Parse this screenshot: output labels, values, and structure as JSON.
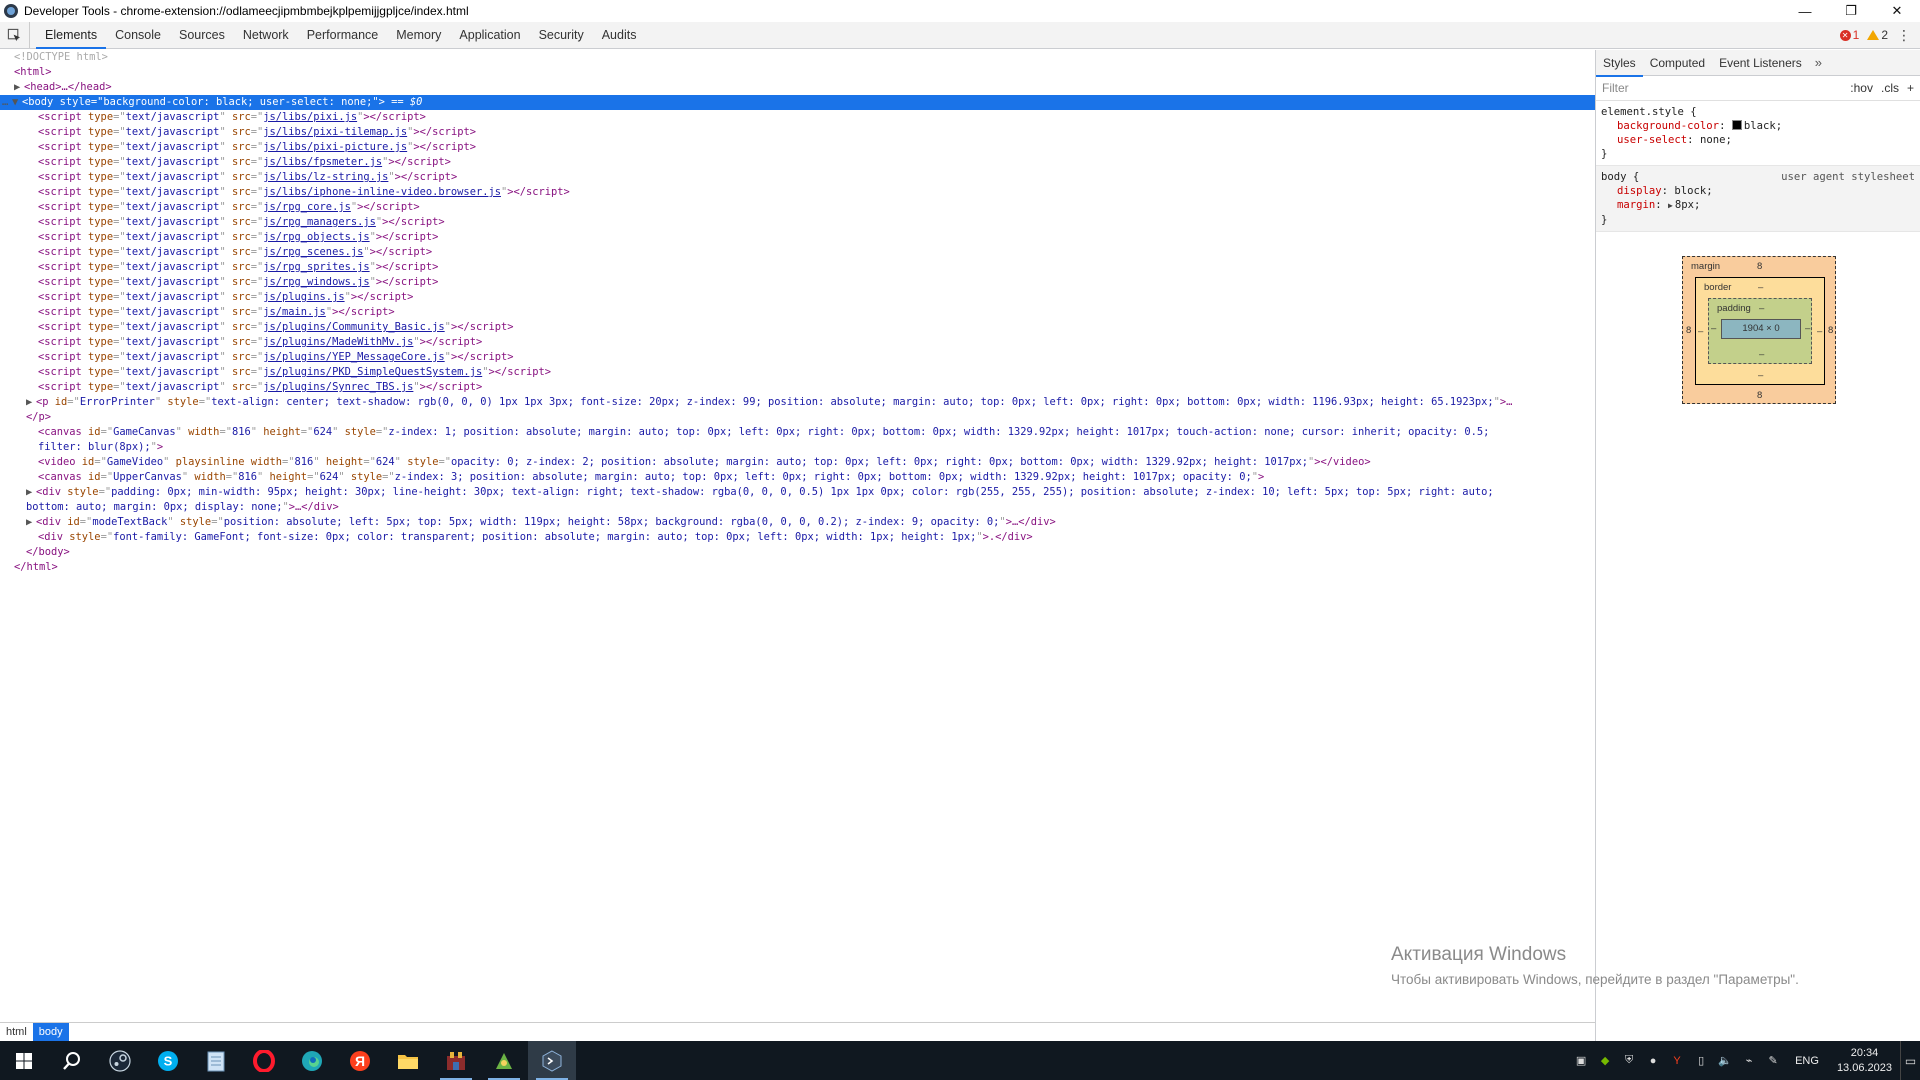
{
  "window": {
    "title": "Developer Tools - chrome-extension://odlameecjipmbmbejkplpemijjgpljce/index.html",
    "controls": [
      "—",
      "❐",
      "✕"
    ]
  },
  "devtools": {
    "tabs": [
      "Elements",
      "Console",
      "Sources",
      "Network",
      "Performance",
      "Memory",
      "Application",
      "Security",
      "Audits"
    ],
    "error_count": "1",
    "warning_count": "2"
  },
  "dom": {
    "doctype": "<!DOCTYPE html>",
    "html_open": "<html>",
    "head": "<head>…</head>",
    "body_open_tag": "body",
    "body_style": "background-color: black; user-select: none;",
    "body_marker": "== $0",
    "scripts": [
      "js/libs/pixi.js",
      "js/libs/pixi-tilemap.js",
      "js/libs/pixi-picture.js",
      "js/libs/fpsmeter.js",
      "js/libs/lz-string.js",
      "js/libs/iphone-inline-video.browser.js",
      "js/rpg_core.js",
      "js/rpg_managers.js",
      "js/rpg_objects.js",
      "js/rpg_scenes.js",
      "js/rpg_sprites.js",
      "js/rpg_windows.js",
      "js/plugins.js",
      "js/main.js",
      "js/plugins/Community_Basic.js",
      "js/plugins/MadeWithMv.js",
      "js/plugins/YEP_MessageCore.js",
      "js/plugins/PKD_SimpleQuestSystem.js",
      "js/plugins/Synrec_TBS.js"
    ],
    "script_type": "text/javascript",
    "error_printer_style": "text-align: center; text-shadow: rgb(0, 0, 0) 1px 1px 3px; font-size: 20px; z-index: 99; position: absolute; margin: auto; top: 0px; left: 0px; right: 0px; bottom: 0px; width: 1196.93px; height: 65.1923px;",
    "p_close": "</p>",
    "game_canvas_style_1": "z-index: 1; position: absolute; margin: auto; top: 0px; left: 0px; right: 0px; bottom: 0px; width: 1329.92px; height: 1017px; touch-action: none; cursor: inherit; opacity: 0.5;",
    "game_canvas_style_2": "filter: blur(8px);",
    "game_video_style": "opacity: 0; z-index: 2; position: absolute; margin: auto; top: 0px; left: 0px; right: 0px; bottom: 0px; width: 1329.92px; height: 1017px;",
    "upper_canvas_style": "z-index: 3; position: absolute; margin: auto; top: 0px; left: 0px; right: 0px; bottom: 0px; width: 1329.92px; height: 1017px; opacity: 0;",
    "div1_style_1": "padding: 0px; min-width: 95px; height: 30px; line-height: 30px; text-align: right; text-shadow: rgba(0, 0, 0, 0.5) 1px 1px 0px; color: rgb(255, 255, 255); position: absolute; z-index: 10; left: 5px; top: 5px; right: auto;",
    "div1_style_2": "bottom: auto; margin: 0px; display: none;",
    "mode_text_style": "position: absolute; left: 5px; top: 5px; width: 119px; height: 58px; background: rgba(0, 0, 0, 0.2); z-index: 9; opacity: 0;",
    "font_div_style": "font-family: GameFont; font-size: 0px; color: transparent; position: absolute; margin: auto; top: 0px; left: 0px; width: 1px; height: 1px;",
    "body_close": "</body>",
    "html_close": "</html>"
  },
  "breadcrumbs": [
    "html",
    "body"
  ],
  "styles": {
    "tabs": [
      "Styles",
      "Computed",
      "Event Listeners"
    ],
    "filter_placeholder": "Filter",
    "hov": ":hov",
    "cls": ".cls",
    "plus": "+",
    "element_style_selector": "element.style {",
    "element_decls": [
      {
        "name": "background-color",
        "value": "black;"
      },
      {
        "name": "user-select",
        "value": "none;"
      }
    ],
    "close_brace": "}",
    "body_selector": "body {",
    "ua_origin": "user agent stylesheet",
    "body_decls": [
      {
        "name": "display",
        "value": "block;"
      },
      {
        "name": "margin",
        "value": "8px;"
      }
    ]
  },
  "box_model": {
    "margin_label": "margin",
    "margin_top": "8",
    "margin_bottom": "8",
    "margin_left": "8",
    "margin_right": "8",
    "border_label": "border",
    "border_value": "–",
    "padding_label": "padding",
    "padding_value": "–",
    "content": "1904 × 0",
    "dash": "–"
  },
  "watermark": {
    "title": "Активация Windows",
    "subtitle": "Чтобы активировать Windows, перейдите в раздел \"Параметры\"."
  },
  "taskbar": {
    "apps": [
      "windows-start",
      "search",
      "steam",
      "skype",
      "notepad",
      "opera",
      "edge",
      "yandex-browser",
      "file-explorer",
      "rpg-game",
      "rpgmaker",
      "devtools"
    ],
    "lang": "ENG",
    "time": "20:34",
    "date": "13.06.2023"
  }
}
